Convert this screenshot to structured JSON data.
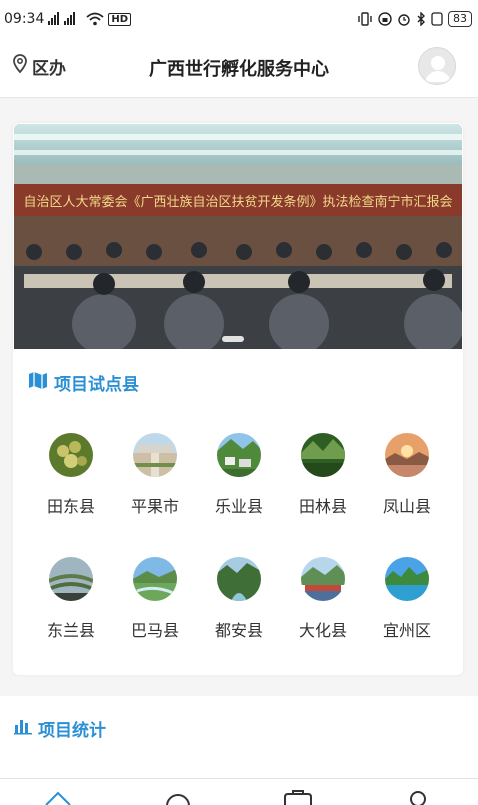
{
  "status": {
    "time": "09:34",
    "network": "4G",
    "hd": "HD",
    "battery": "83"
  },
  "header": {
    "location_label": "区办",
    "title": "广西世行孵化服务中心"
  },
  "banner": {
    "caption": "自治区人大常委会《广西壮族自治区扶贫开发条例》执法检查南宁市汇报会"
  },
  "pilot_counties": {
    "heading": "项目试点县",
    "items": [
      {
        "name": "田东县",
        "icon": "fruit-photo"
      },
      {
        "name": "平果市",
        "icon": "plaza-photo"
      },
      {
        "name": "乐业县",
        "icon": "village-photo"
      },
      {
        "name": "田林县",
        "icon": "mountain-photo"
      },
      {
        "name": "凤山县",
        "icon": "sunset-photo"
      },
      {
        "name": "东兰县",
        "icon": "terrace-photo"
      },
      {
        "name": "巴马县",
        "icon": "river-photo"
      },
      {
        "name": "都安县",
        "icon": "valley-photo"
      },
      {
        "name": "大化县",
        "icon": "town-photo"
      },
      {
        "name": "宜州区",
        "icon": "lake-photo"
      }
    ]
  },
  "statistics": {
    "heading": "项目统计"
  },
  "colors": {
    "accent": "#2b8fd6",
    "card_bg": "#ffffff",
    "page_bg": "#f5f5f5"
  }
}
